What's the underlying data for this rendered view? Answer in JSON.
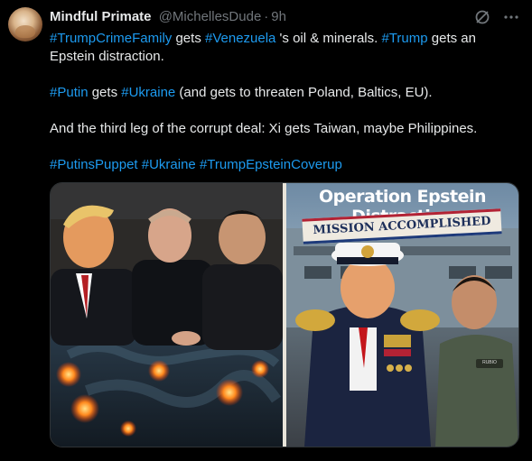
{
  "author": {
    "name": "Mindful Primate",
    "handle": "@MichellesDude",
    "separator": "·",
    "time": "9h"
  },
  "header_icons": [
    "grok-icon",
    "more-options-icon"
  ],
  "tweet": {
    "p1": {
      "t1": "#TrumpCrimeFamily",
      "t2": " gets ",
      "t3": "#Venezuela",
      "t4": " 's oil & minerals.  ",
      "t5": "#Trump",
      "t6": " gets an Epstein distraction."
    },
    "p2": {
      "t1": "#Putin",
      "t2": " gets ",
      "t3": "#Ukraine",
      "t4": " (and gets to threaten Poland, Baltics, EU)."
    },
    "p3": {
      "t1": "And the third leg of the corrupt deal:  Xi gets Taiwan, maybe Philippines."
    },
    "p4": {
      "t1": "#PutinsPuppet",
      "t2": " ",
      "t3": "#Ukraine",
      "t4": " ",
      "t5": "#TrumpEpsteinCoverup"
    }
  },
  "media": {
    "right_title": "Operation Epstein Distraction",
    "right_banner": "MISSION ACCOMPLISHED",
    "name_tag": "RUBIO"
  },
  "colors": {
    "background": "#000000",
    "text": "#e7e9ea",
    "muted": "#71767b",
    "link": "#1d9bf0"
  }
}
